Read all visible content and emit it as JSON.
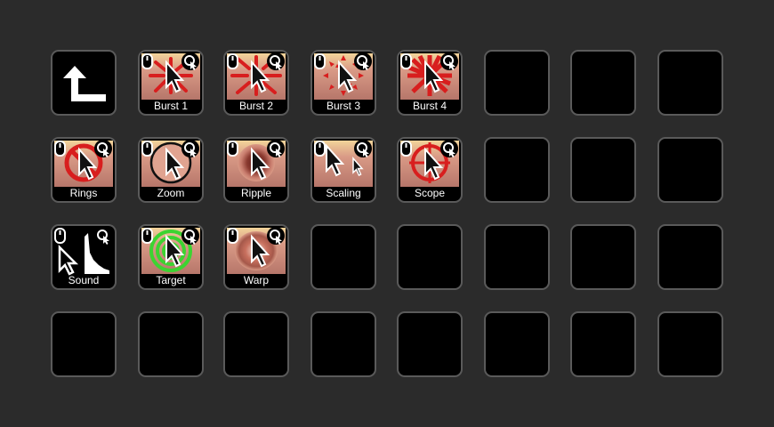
{
  "deck": {
    "back_key": {
      "icon": "back-arrow-icon"
    },
    "effect_keys": [
      {
        "label": "Burst 1",
        "icon": "burst-icon"
      },
      {
        "label": "Burst 2",
        "icon": "burst-icon"
      },
      {
        "label": "Burst 3",
        "icon": "burst-icon"
      },
      {
        "label": "Burst 4",
        "icon": "burst-icon"
      },
      {
        "label": "Rings",
        "icon": "rings-icon"
      },
      {
        "label": "Zoom",
        "icon": "zoom-icon"
      },
      {
        "label": "Ripple",
        "icon": "ripple-icon"
      },
      {
        "label": "Scaling",
        "icon": "scaling-icon"
      },
      {
        "label": "Scope",
        "icon": "scope-icon"
      },
      {
        "label": "Sound",
        "icon": "sound-icon"
      },
      {
        "label": "Target",
        "icon": "target-icon"
      },
      {
        "label": "Warp",
        "icon": "warp-icon"
      }
    ],
    "badge_icons": [
      "mouse-icon",
      "click-cursor-icon"
    ],
    "colors": {
      "background": "#2b2b2b",
      "key_border": "#5a5a5a",
      "key_fill": "#000000",
      "skin_gradient_top": "#f2d49a",
      "skin_gradient_mid": "#d99a86",
      "skin_gradient_bottom": "#b6766a",
      "effect_red": "#d81e1e",
      "target_green": "#3cd431"
    }
  }
}
